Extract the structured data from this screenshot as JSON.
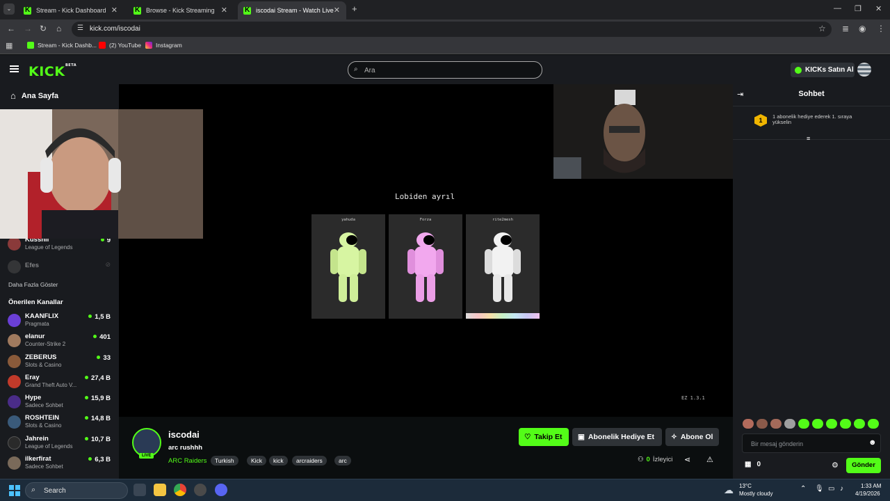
{
  "browser": {
    "tabs": [
      {
        "title": "Stream - Kick Dashboard",
        "active": false
      },
      {
        "title": "Browse - Kick Streaming",
        "active": false
      },
      {
        "title": "iscodai Stream - Watch Live",
        "active": true
      }
    ],
    "url": "kick.com/iscodai",
    "bookmarks": [
      "Stream - Kick Dashb...",
      "(2) YouTube",
      "Instagram"
    ]
  },
  "header": {
    "logo": "KICK",
    "logo_badge": "BETA",
    "search_placeholder": "Ara",
    "kicks_button": "KICKs Satın Al"
  },
  "sidebar": {
    "home_label": "Ana Sayfa",
    "followed": [
      {
        "name": "Kussnii",
        "category": "League of Legends",
        "viewers": "9"
      },
      {
        "name": "Efes",
        "category": "",
        "viewers": ""
      }
    ],
    "show_more": "Daha Fazla Göster",
    "recommended_title": "Önerilen Kanallar",
    "recommended": [
      {
        "name": "KAANFLIX",
        "category": "Pragmata",
        "viewers": "1,5 B",
        "color": "#6a3fd6"
      },
      {
        "name": "elanur",
        "category": "Counter-Strike 2",
        "viewers": "401",
        "color": "#a07a5e"
      },
      {
        "name": "ZEBERUS",
        "category": "Slots & Casino",
        "viewers": "33",
        "color": "#8a5a3a"
      },
      {
        "name": "Eray",
        "category": "Grand Theft Auto V...",
        "viewers": "27,4 B",
        "color": "#c13a2a"
      },
      {
        "name": "Hype",
        "category": "Sadece Sohbet",
        "viewers": "15,9 B",
        "color": "#4a2c88"
      },
      {
        "name": "ROSHTEIN",
        "category": "Slots & Casino",
        "viewers": "14,8 B",
        "color": "#3a5a7a"
      },
      {
        "name": "Jahrein",
        "category": "League of Legends",
        "viewers": "10,7 B",
        "color": "#2a2a2a"
      },
      {
        "name": "ilkerfirat",
        "category": "Sadece Sohbet",
        "viewers": "6,3 B",
        "color": "#7a6a5a"
      }
    ]
  },
  "player": {
    "lobby_text": "Lobiden ayrıl",
    "players": [
      {
        "name": "yahuda",
        "suit_color": "#d7f5a2"
      },
      {
        "name": "Forza",
        "suit_color": "#f2a8ee"
      },
      {
        "name": "rite2mesh",
        "suit_color": "#f2f2f2"
      }
    ],
    "version": "EZ 1.3.1"
  },
  "stream": {
    "streamer": "iscodai",
    "title": "arc rushhh",
    "category": "ARC Raiders",
    "tags": [
      "Turkish",
      "Kick",
      "kick",
      "arcraiders",
      "arc"
    ],
    "live_badge": "LIVE",
    "viewers": "0",
    "viewers_label": "İzleyici",
    "follow_label": "Takip Et",
    "gift_label": "Abonelik Hediye Et",
    "subscribe_label": "Abone Ol"
  },
  "chat": {
    "title": "Sohbet",
    "gift_rank": "1",
    "gift_text": "1 abonelik hediye ederek 1. sıraya yükselin",
    "input_placeholder": "Bir mesaj gönderin",
    "kicks_count": "0",
    "send_label": "Gönder",
    "accent": "#53fc18"
  },
  "taskbar": {
    "search_label": "Search",
    "weather_temp": "13°C",
    "weather_desc": "Mostly cloudy",
    "time": "1:33 AM",
    "date": "4/19/2026"
  }
}
